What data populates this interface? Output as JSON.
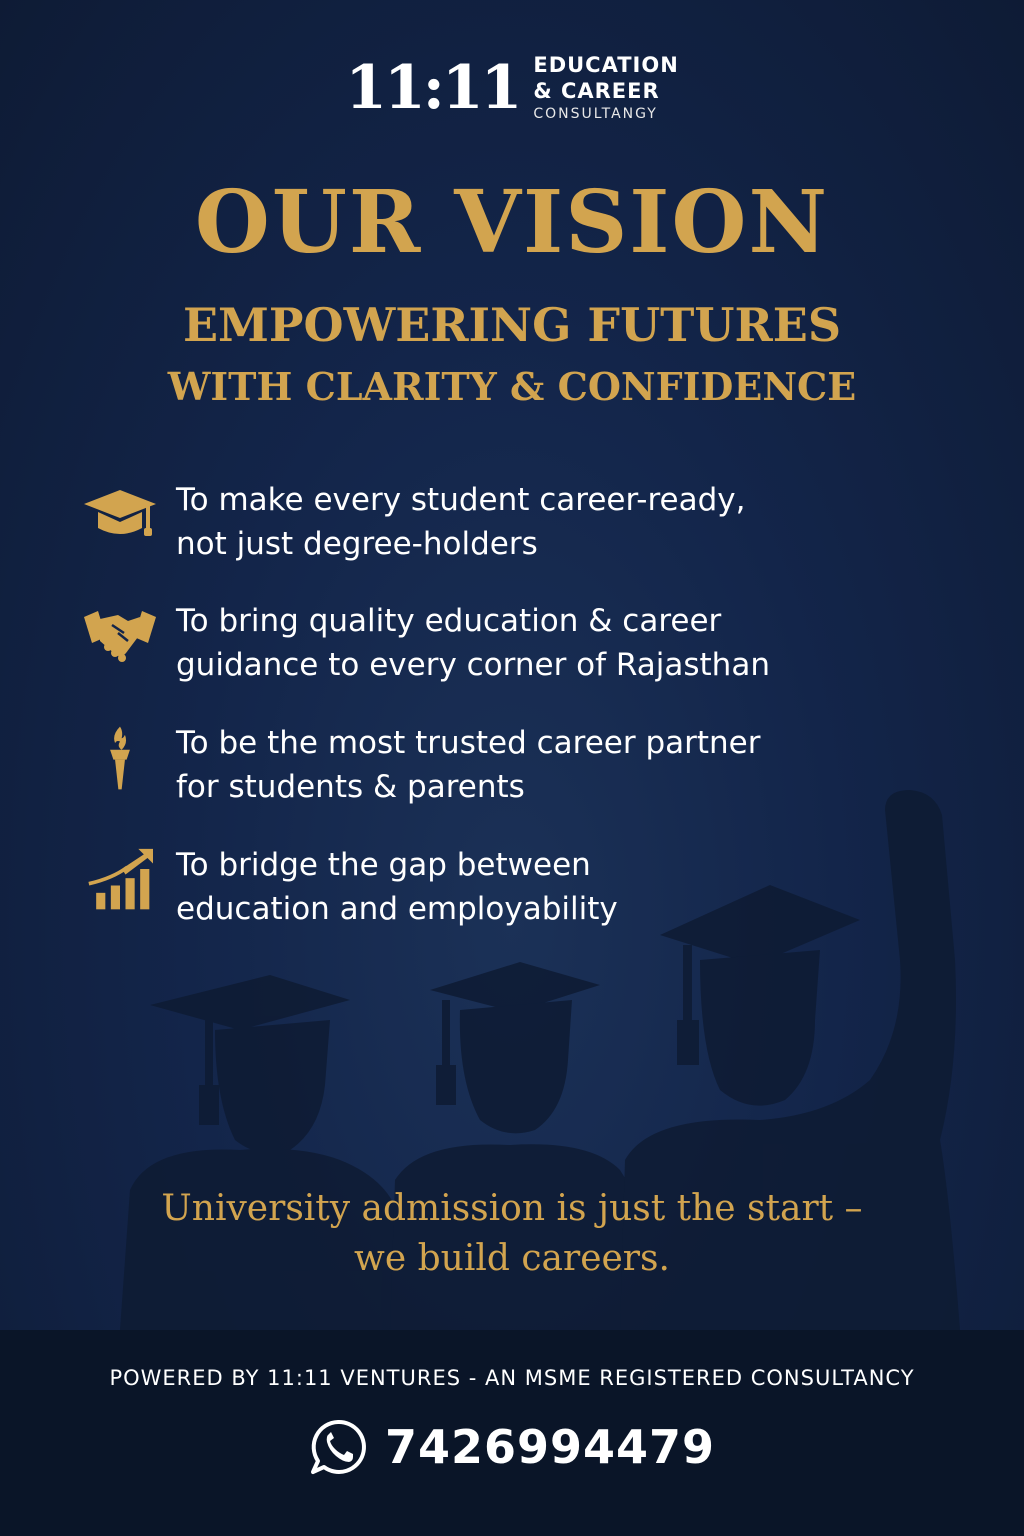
{
  "brand": {
    "mark": "11:11",
    "line1": "EDUCATION",
    "line2": "& CAREER",
    "line3": "CONSULTANGY"
  },
  "heading": {
    "title": "OUR VISION",
    "subtitle": "EMPOWERING FUTURES",
    "subtitle2": "WITH CLARITY & CONFIDENCE"
  },
  "vision_items": [
    {
      "icon": "graduation-cap-icon",
      "line1": "To make every student career-ready,",
      "line2": "not just degree-holders"
    },
    {
      "icon": "handshake-icon",
      "line1": "To bring quality education & career",
      "line2": "guidance to every corner of Rajasthan"
    },
    {
      "icon": "torch-icon",
      "line1": "To be the most trusted career partner",
      "line2": "for students & parents"
    },
    {
      "icon": "growth-chart-icon",
      "line1": "To bridge the gap between",
      "line2": "education and employability"
    }
  ],
  "tagline": {
    "line1": "University admission is just the start –",
    "line2": "we build careers."
  },
  "footer": {
    "powered_by": "POWERED BY 11:11 VENTURES - AN MSME REGISTERED CONSULTANCY",
    "phone": "7426994479",
    "phone_icon": "whatsapp-icon"
  },
  "colors": {
    "background": "#13254a",
    "gold": "#d2a44f",
    "text": "#ffffff",
    "footer": "#0a1528"
  }
}
